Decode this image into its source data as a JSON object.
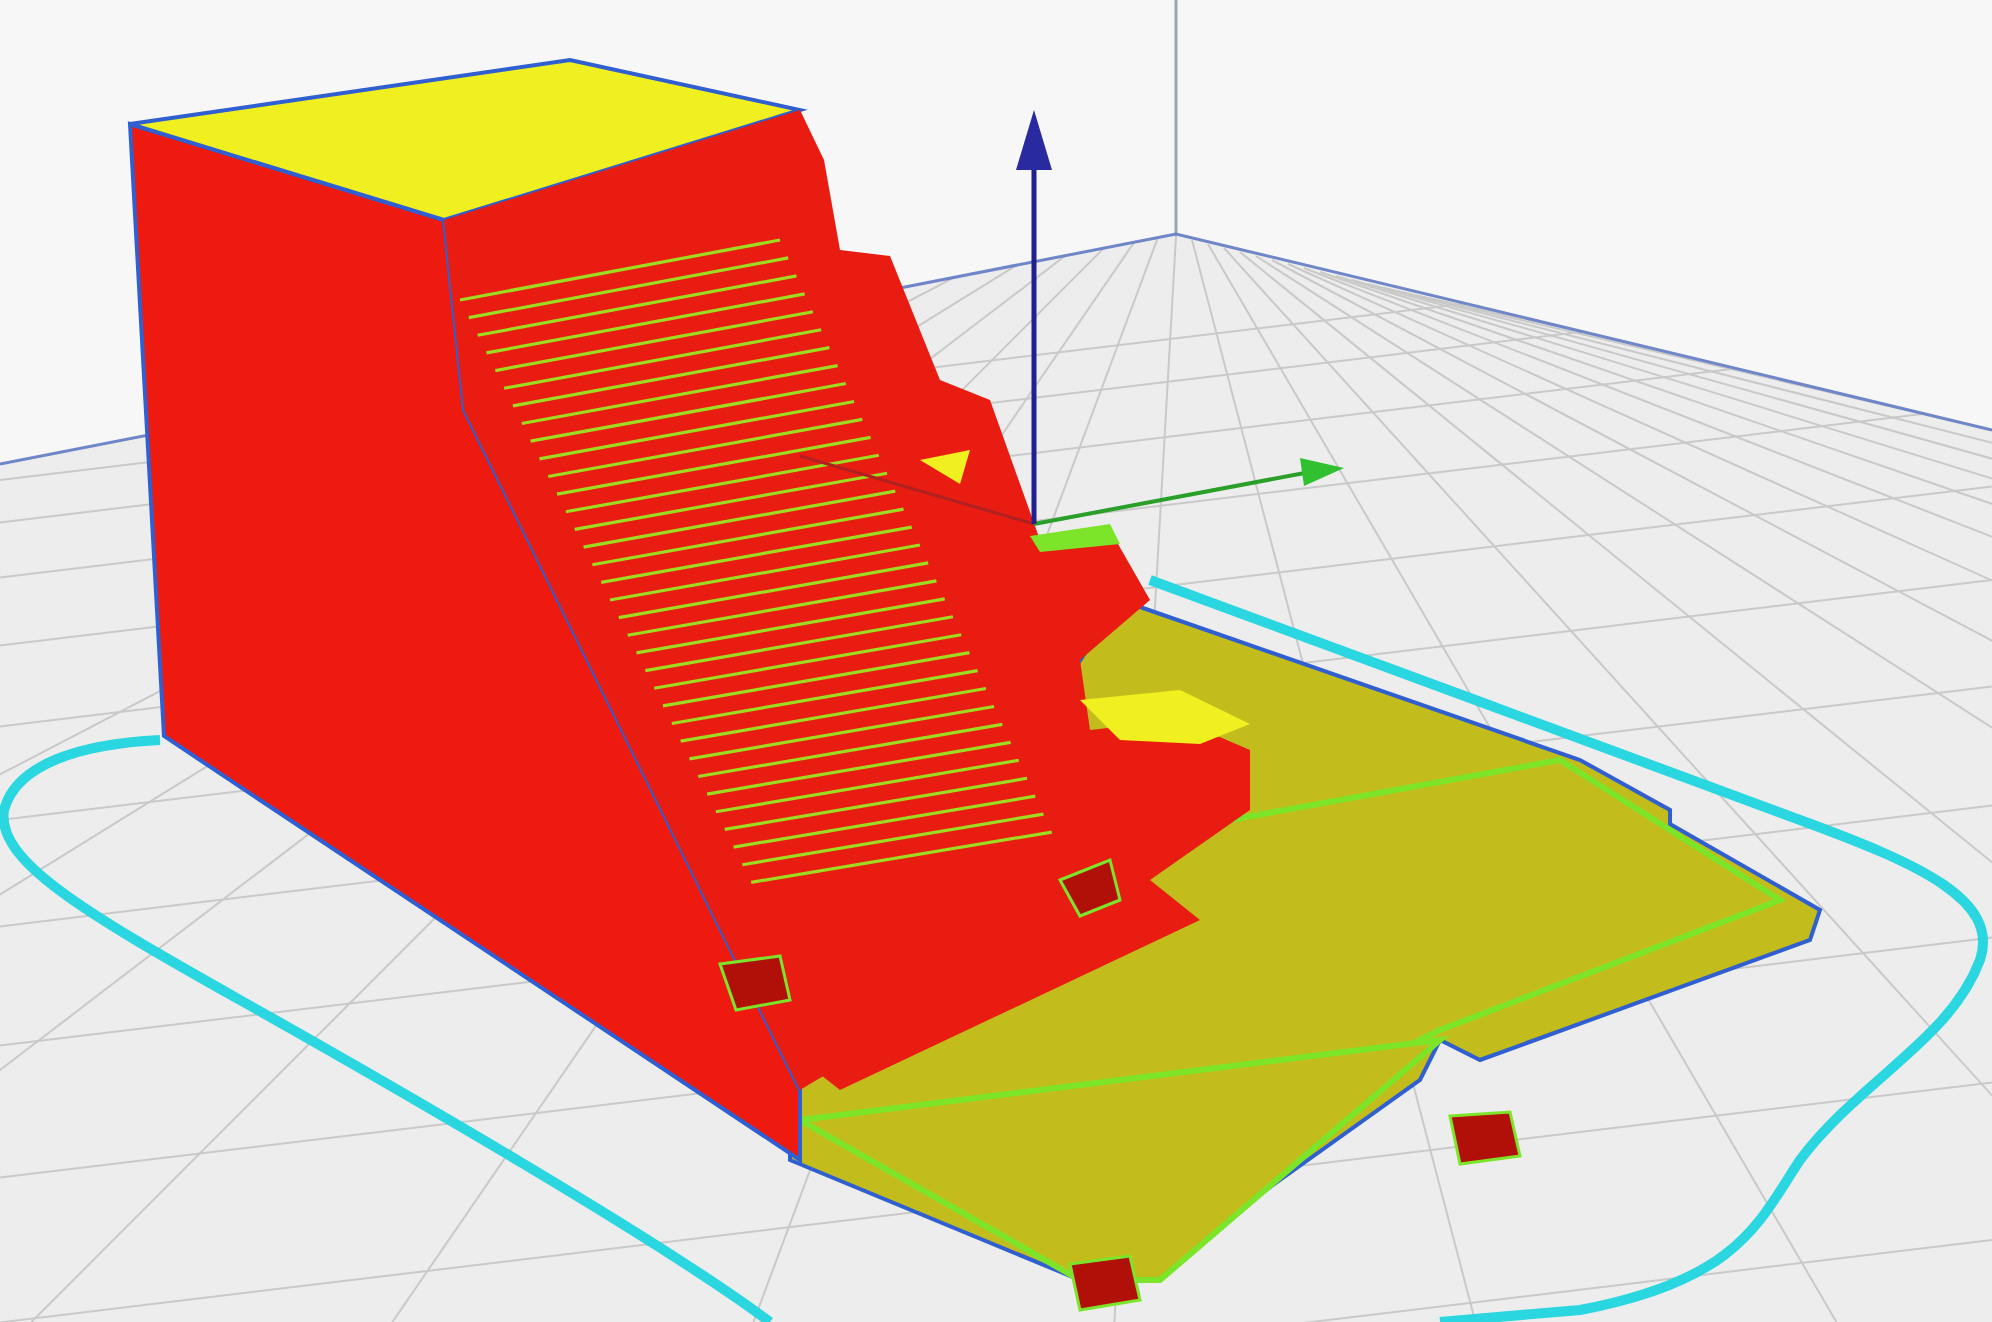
{
  "viewport": {
    "kind": "layer-view"
  }
}
